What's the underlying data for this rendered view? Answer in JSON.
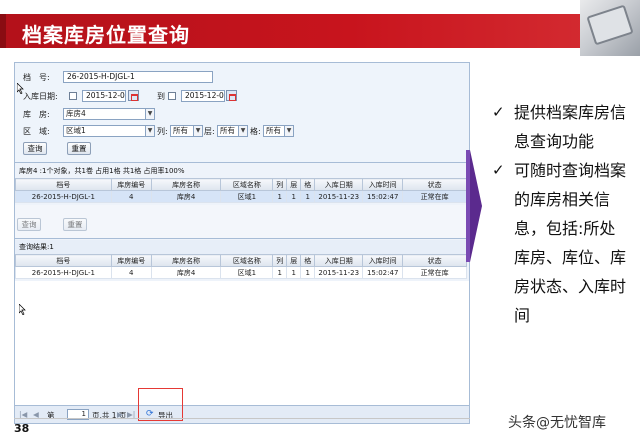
{
  "slide": {
    "title": "档案库房位置查询",
    "page_number": "38",
    "watermark": "头条@无忧智库"
  },
  "form": {
    "archive_no_label": "档　号:",
    "archive_no_value": "26-2015-H-DJGL-1",
    "date_label": "入库日期:",
    "date_from": "2015-12-03",
    "to_label": "到",
    "date_to": "2015-12-03",
    "warehouse_label": "库　房:",
    "warehouse_value": "库房4",
    "area_label": "区　域:",
    "area_value": "区域1",
    "column_label": "列:",
    "column_value": "所有",
    "layer_label": "层:",
    "layer_value": "所有",
    "cell_label": "格:",
    "cell_value": "所有",
    "query_button": "查询",
    "reset_button": "重置"
  },
  "summary": {
    "text": "库房4 :1个对象，共1卷 占用1格 共1格 占用率100%",
    "columns": [
      "档号",
      "库房编号",
      "库房名称",
      "区域名称",
      "列",
      "层",
      "格",
      "入库日期",
      "入库时间",
      "状态"
    ],
    "rows": [
      [
        "26-2015-H-DJGL-1",
        "4",
        "库房4",
        "区域1",
        "1",
        "1",
        "1",
        "2015-11-23",
        "15:02:47",
        "正常在库"
      ]
    ],
    "ghost_query": "查询",
    "ghost_reset": "重置"
  },
  "results": {
    "label": "查询结果:1",
    "columns": [
      "档号",
      "库房编号",
      "库房名称",
      "区域名称",
      "列",
      "层",
      "格",
      "入库日期",
      "入库时间",
      "状态"
    ],
    "rows": [
      [
        "26-2015-H-DJGL-1",
        "4",
        "库房4",
        "区域1",
        "1",
        "1",
        "1",
        "2015-11-23",
        "15:02:47",
        "正常在库"
      ]
    ]
  },
  "pager": {
    "page_prefix": "第",
    "page_value": "1",
    "page_suffix": "页,共 1 页",
    "export_label": "导出"
  },
  "bullets": [
    "提供档案库房信息查询功能",
    "可随时查询档案的库房相关信息，包括:所处库房、库位、库房状态、入库时间"
  ],
  "colors": {
    "title_red": "#c8141d",
    "arrow_purple": "#5b2a8e",
    "export_highlight": "#e53935"
  }
}
